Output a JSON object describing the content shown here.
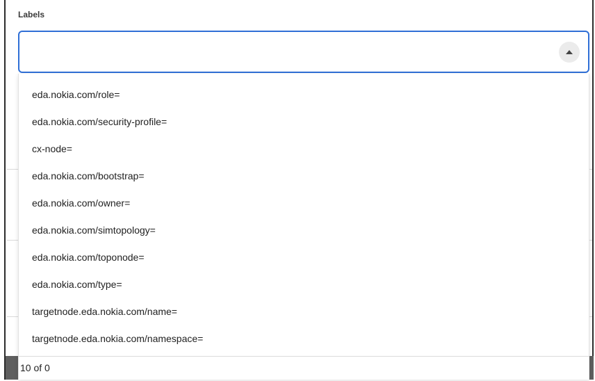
{
  "field": {
    "label": "Labels",
    "value": ""
  },
  "dropdown": {
    "options": [
      "eda.nokia.com/role=",
      "eda.nokia.com/security-profile=",
      "cx-node=",
      "eda.nokia.com/bootstrap=",
      "eda.nokia.com/owner=",
      "eda.nokia.com/simtopology=",
      "eda.nokia.com/toponode=",
      "eda.nokia.com/type=",
      "targetnode.eda.nokia.com/name=",
      "targetnode.eda.nokia.com/namespace="
    ],
    "footer_count": "10 of 0"
  },
  "icons": {
    "toggle": "chevron-up-icon"
  },
  "colors": {
    "focus_border": "#2f6fd6",
    "toggle_bg": "#ebebeb"
  }
}
